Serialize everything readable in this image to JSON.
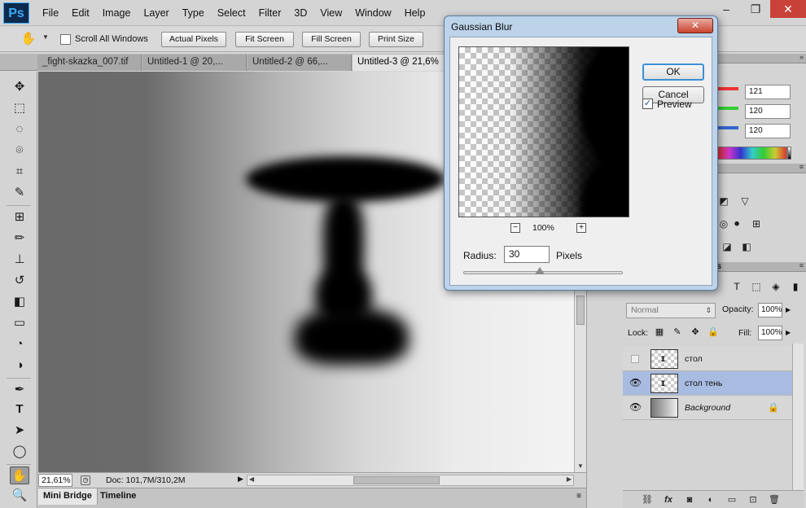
{
  "app": {
    "logo": "Ps"
  },
  "menu": [
    "File",
    "Edit",
    "Image",
    "Layer",
    "Type",
    "Select",
    "Filter",
    "3D",
    "View",
    "Window",
    "Help"
  ],
  "window_controls": {
    "minimize": "–",
    "restore": "❐",
    "close": "✕"
  },
  "options_bar": {
    "scroll_all_label": "Scroll All Windows",
    "buttons": [
      "Actual Pixels",
      "Fit Screen",
      "Fill Screen",
      "Print Size"
    ]
  },
  "tabs": [
    {
      "label": "_fight-skazka_007.tif"
    },
    {
      "label": "Untitled-1 @ 20,..."
    },
    {
      "label": "Untitled-2 @ 66,..."
    },
    {
      "label": "Untitled-3 @ 21,6%"
    }
  ],
  "status": {
    "zoom": "21,61%",
    "doc": "Doc: 101,7M/310,2M"
  },
  "bottom_tabs": [
    "Mini Bridge",
    "Timeline"
  ],
  "color_panel": {
    "r": "121",
    "g": "120",
    "b": "120"
  },
  "layers_panel": {
    "tab_label": "ths",
    "blend_mode": "Normal",
    "opacity_label": "Opacity:",
    "opacity": "100%",
    "lock_label": "Lock:",
    "fill_label": "Fill:",
    "fill": "100%",
    "layers": [
      {
        "name": "стол",
        "visible": false,
        "selected": false
      },
      {
        "name": "стол тень",
        "visible": true,
        "selected": true
      },
      {
        "name": "Background",
        "visible": true,
        "selected": false,
        "locked": true
      }
    ]
  },
  "dialog": {
    "title": "Gaussian Blur",
    "close": "✕",
    "ok": "OK",
    "cancel": "Cancel",
    "preview_label": "Preview",
    "preview_checked": "✓",
    "zoom": "100%",
    "zoom_out": "−",
    "zoom_in": "+",
    "radius_label": "Radius:",
    "radius_value": "30",
    "radius_unit": "Pixels",
    "radius_fraction": 0.12
  },
  "icons": {
    "hand": "✋",
    "move": "✥",
    "marquee": "⬚",
    "lasso": "◌",
    "quick-select": "⌾",
    "crop": "⌗",
    "eyedropper": "✎",
    "heal": "⊞",
    "brush": "✏",
    "stamp": "⊥",
    "history": "↺",
    "eraser": "◧",
    "gradient": "▭",
    "blur": "◔",
    "dodge": "◑",
    "pen": "✒",
    "type": "T",
    "path-select": "➤",
    "shape": "◯",
    "zoom": "🔍"
  }
}
